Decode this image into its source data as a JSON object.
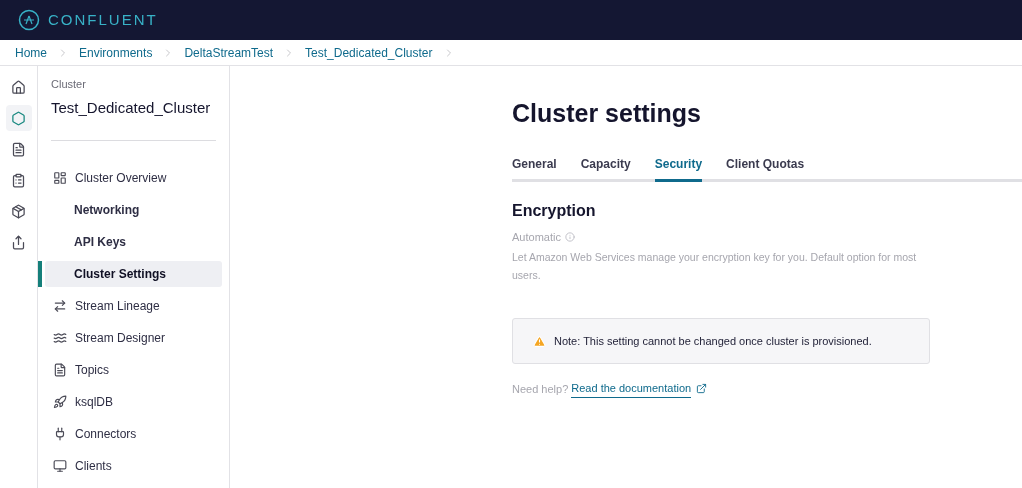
{
  "header": {
    "logo": "CONFLUENT"
  },
  "breadcrumbs": [
    "Home",
    "Environments",
    "DeltaStreamTest",
    "Test_Dedicated_Cluster"
  ],
  "rail": [
    {
      "kind": "home",
      "selected": false
    },
    {
      "kind": "cluster",
      "selected": true
    },
    {
      "kind": "document",
      "selected": false
    },
    {
      "kind": "list",
      "selected": false
    },
    {
      "kind": "package",
      "selected": false
    },
    {
      "kind": "share",
      "selected": false
    }
  ],
  "sidebar": {
    "label": "Cluster",
    "title": "Test_Dedicated_Cluster",
    "items": [
      {
        "label": "Cluster Overview",
        "kind": "overview",
        "selected": false
      },
      {
        "label": "Networking",
        "kind": "sub",
        "selected": false
      },
      {
        "label": "API Keys",
        "kind": "sub",
        "selected": false
      },
      {
        "label": "Cluster Settings",
        "kind": "sub",
        "selected": true
      },
      {
        "label": "Stream Lineage",
        "kind": "lineage",
        "selected": false
      },
      {
        "label": "Stream Designer",
        "kind": "designer",
        "selected": false
      },
      {
        "label": "Topics",
        "kind": "topics",
        "selected": false
      },
      {
        "label": "ksqlDB",
        "kind": "ksqldb",
        "selected": false
      },
      {
        "label": "Connectors",
        "kind": "connectors",
        "selected": false
      },
      {
        "label": "Clients",
        "kind": "clients",
        "selected": false
      }
    ]
  },
  "page": {
    "title": "Cluster settings",
    "tabs": [
      {
        "label": "General",
        "selected": false
      },
      {
        "label": "Capacity",
        "selected": false
      },
      {
        "label": "Security",
        "selected": true
      },
      {
        "label": "Client Quotas",
        "selected": false
      }
    ],
    "section": "Encryption",
    "option": "Automatic",
    "description": "Let Amazon Web Services manage your encryption key for you. Default option for most users.",
    "note": "Note: This setting cannot be changed once cluster is provisioned.",
    "help": "Need help?",
    "link": "Read the documentation"
  }
}
